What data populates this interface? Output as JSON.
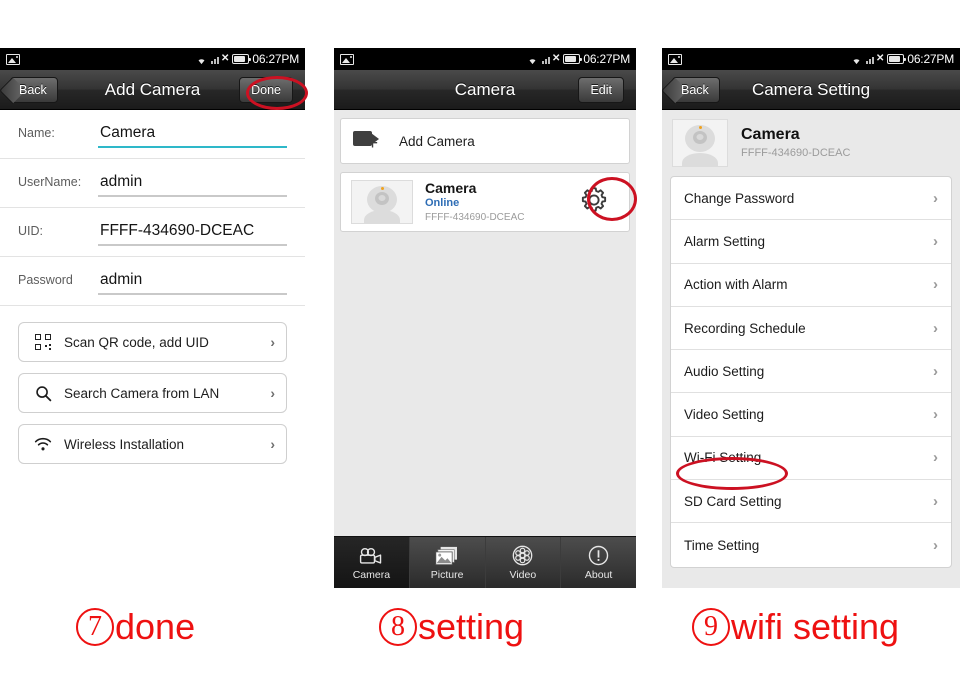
{
  "statusbar": {
    "time": "06:27PM",
    "icons": [
      "photo-icon",
      "wifi-icon",
      "signal-icon",
      "signal-off-icon",
      "battery-icon"
    ]
  },
  "panel1": {
    "nav": {
      "back": "Back",
      "title": "Add Camera",
      "action": "Done"
    },
    "fields": [
      {
        "label": "Name:",
        "value": "Camera",
        "focused": true
      },
      {
        "label": "UserName:",
        "value": "admin",
        "focused": false
      },
      {
        "label": "UID:",
        "value": "FFFF-434690-DCEAC",
        "focused": false
      },
      {
        "label": "Password",
        "value": "admin",
        "focused": false
      }
    ],
    "options": [
      {
        "icon": "qr-code-icon",
        "label": "Scan QR code, add UID",
        "chevron": "›"
      },
      {
        "icon": "search-icon",
        "label": "Search Camera from LAN",
        "chevron": "›"
      },
      {
        "icon": "wifi-icon",
        "label": "Wireless Installation",
        "chevron": "›"
      }
    ]
  },
  "panel2": {
    "nav": {
      "title": "Camera",
      "action": "Edit"
    },
    "add_row": {
      "icon": "add-camera-icon",
      "label": "Add Camera"
    },
    "camera": {
      "name": "Camera",
      "status": "Online",
      "uid": "FFFF-434690-DCEAC",
      "settings_icon": "gear-icon"
    },
    "tabs": [
      {
        "label": "Camera",
        "icon": "video-camera-icon",
        "active": true
      },
      {
        "label": "Picture",
        "icon": "pictures-icon",
        "active": false
      },
      {
        "label": "Video",
        "icon": "film-reel-icon",
        "active": false
      },
      {
        "label": "About",
        "icon": "info-icon",
        "active": false
      }
    ]
  },
  "panel3": {
    "nav": {
      "back": "Back",
      "title": "Camera Setting"
    },
    "device": {
      "name": "Camera",
      "uid": "FFFF-434690-DCEAC"
    },
    "rows": [
      {
        "label": "Change Password",
        "chevron": "›",
        "highlighted": false
      },
      {
        "label": "Alarm Setting",
        "chevron": "›",
        "highlighted": false
      },
      {
        "label": "Action with Alarm",
        "chevron": "›",
        "highlighted": false
      },
      {
        "label": "Recording Schedule",
        "chevron": "›",
        "highlighted": false
      },
      {
        "label": "Audio Setting",
        "chevron": "›",
        "highlighted": false
      },
      {
        "label": "Video Setting",
        "chevron": "›",
        "highlighted": false
      },
      {
        "label": "Wi-Fi Setting",
        "chevron": "›",
        "highlighted": true
      },
      {
        "label": "SD Card Setting",
        "chevron": "›",
        "highlighted": false
      },
      {
        "label": "Time Setting",
        "chevron": "›",
        "highlighted": false
      }
    ]
  },
  "captions": [
    {
      "num": "7",
      "text": "done"
    },
    {
      "num": "8",
      "text": "setting"
    },
    {
      "num": "9",
      "text": "wifi setting"
    }
  ],
  "colors": {
    "annotation_red": "#ee1111",
    "circle_red": "#cc1122",
    "focused_underline": "#2eb8c9",
    "status_online": "#2e6db5"
  }
}
